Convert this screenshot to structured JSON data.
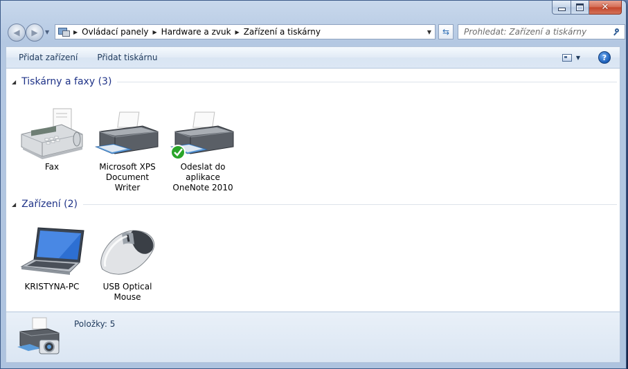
{
  "window": {
    "controls": {
      "minimize": "minimize",
      "maximize": "maximize",
      "close": "close"
    }
  },
  "address_bar": {
    "breadcrumbs": [
      "Ovládací panely",
      "Hardware a zvuk",
      "Zařízení a tiskárny"
    ]
  },
  "search": {
    "placeholder": "Prohledat: Zařízení a tiskárny"
  },
  "toolbar": {
    "add_device": "Přidat zařízení",
    "add_printer": "Přidat tiskárnu"
  },
  "groups": [
    {
      "title": "Tiskárny a faxy (3)",
      "items": [
        {
          "label": "Fax",
          "icon": "fax-icon"
        },
        {
          "label": "Microsoft XPS Document Writer",
          "icon": "printer-icon"
        },
        {
          "label": "Odeslat do aplikace OneNote 2010",
          "icon": "printer-default-icon"
        }
      ]
    },
    {
      "title": "Zařízení (2)",
      "items": [
        {
          "label": "KRISTYNA-PC",
          "icon": "laptop-icon"
        },
        {
          "label": "USB Optical Mouse",
          "icon": "mouse-icon"
        }
      ]
    }
  ],
  "details": {
    "count": "Položky: 5"
  },
  "colors": {
    "group_title": "#1e3287",
    "toolbar_text": "#1e395b",
    "default_check": "#2aa52a"
  }
}
